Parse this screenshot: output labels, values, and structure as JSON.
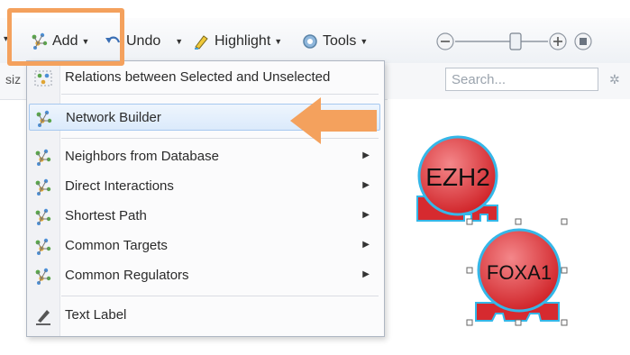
{
  "toolbar": {
    "add_label": "Add",
    "undo_label": "Undo",
    "highlight_label": "Highlight",
    "tools_label": "Tools",
    "left_partial_text": "siz"
  },
  "search": {
    "placeholder": "Search..."
  },
  "menu": {
    "items": [
      {
        "label": "Relations between Selected and Unselected",
        "icon": "relations-icon",
        "submenu": false
      },
      {
        "label": "Network Builder",
        "icon": "network-icon",
        "submenu": false,
        "highlighted": true
      },
      {
        "label": "Neighbors from Database",
        "icon": "network-icon",
        "submenu": true
      },
      {
        "label": "Direct Interactions",
        "icon": "network-icon",
        "submenu": true
      },
      {
        "label": "Shortest Path",
        "icon": "network-icon",
        "submenu": true
      },
      {
        "label": "Common Targets",
        "icon": "network-icon",
        "submenu": true
      },
      {
        "label": "Common Regulators",
        "icon": "network-icon",
        "submenu": true
      },
      {
        "label": "Text Label",
        "icon": "pencil-icon",
        "submenu": false
      }
    ]
  },
  "nodes": [
    {
      "label": "EZH2"
    },
    {
      "label": "FOXA1"
    }
  ],
  "colors": {
    "highlight_accent": "#f4a15d",
    "node_fill": "#e23a3e",
    "node_outline": "#35b7e8"
  }
}
